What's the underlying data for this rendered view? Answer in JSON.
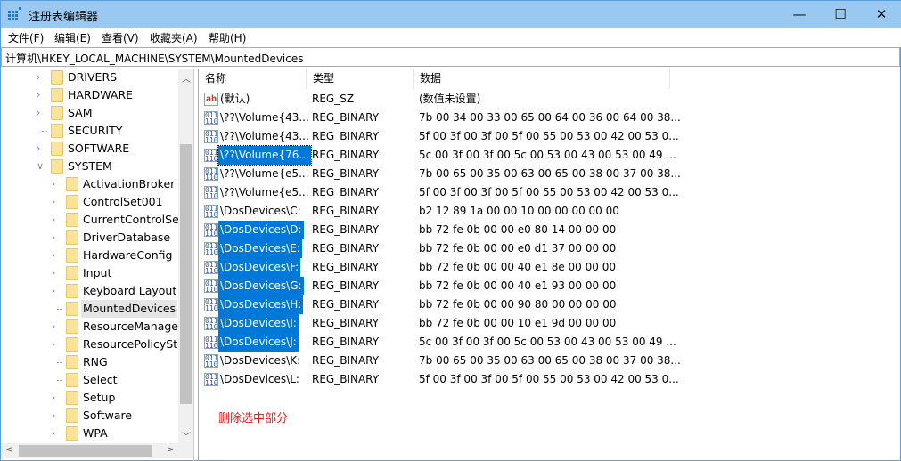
{
  "window": {
    "title": "注册表编辑器",
    "minimize": "—",
    "maximize": "☐",
    "close": "✕"
  },
  "menu": [
    "文件(F)",
    "编辑(E)",
    "查看(V)",
    "收藏夹(A)",
    "帮助(H)"
  ],
  "address": "计算机\\HKEY_LOCAL_MACHINE\\SYSTEM\\MountedDevices",
  "tree": [
    {
      "label": "DRIVERS",
      "level": 1,
      "expandable": true
    },
    {
      "label": "HARDWARE",
      "level": 1,
      "expandable": true
    },
    {
      "label": "SAM",
      "level": 1,
      "expandable": true
    },
    {
      "label": "SECURITY",
      "level": 1,
      "expandable": false
    },
    {
      "label": "SOFTWARE",
      "level": 1,
      "expandable": true
    },
    {
      "label": "SYSTEM",
      "level": 1,
      "expanded": true
    },
    {
      "label": "ActivationBroker",
      "level": 2,
      "expandable": true
    },
    {
      "label": "ControlSet001",
      "level": 2,
      "expandable": true
    },
    {
      "label": "CurrentControlSet",
      "level": 2,
      "expandable": true
    },
    {
      "label": "DriverDatabase",
      "level": 2,
      "expandable": true
    },
    {
      "label": "HardwareConfig",
      "level": 2,
      "expandable": true
    },
    {
      "label": "Input",
      "level": 2,
      "expandable": true
    },
    {
      "label": "Keyboard Layout",
      "level": 2,
      "expandable": true
    },
    {
      "label": "MountedDevices",
      "level": 2,
      "expandable": false,
      "selected": true
    },
    {
      "label": "ResourceManager",
      "level": 2,
      "expandable": true
    },
    {
      "label": "ResourcePolicySto",
      "level": 2,
      "expandable": true
    },
    {
      "label": "RNG",
      "level": 2,
      "expandable": false
    },
    {
      "label": "Select",
      "level": 2,
      "expandable": false
    },
    {
      "label": "Setup",
      "level": 2,
      "expandable": true
    },
    {
      "label": "Software",
      "level": 2,
      "expandable": true
    },
    {
      "label": "WPA",
      "level": 2,
      "expandable": true
    }
  ],
  "columns": {
    "name": "名称",
    "type": "类型",
    "data": "数据"
  },
  "rows": [
    {
      "name": "(默认)",
      "type": "REG_SZ",
      "data": "(数值未设置)",
      "icon": "string"
    },
    {
      "name": "\\??\\Volume{43...",
      "type": "REG_BINARY",
      "data": "7b 00 34 00 33 00 65 00 64 00 36 00 64 00 38...",
      "icon": "binary"
    },
    {
      "name": "\\??\\Volume{43...",
      "type": "REG_BINARY",
      "data": "5f 00 3f 00 3f 00 5f 00 55 00 53 00 42 00 53 0...",
      "icon": "binary"
    },
    {
      "name": "\\??\\Volume{76...",
      "type": "REG_BINARY",
      "data": "5c 00 3f 00 3f 00 5c 00 53 00 43 00 53 00 49 ...",
      "icon": "binary",
      "selected": true,
      "focused": true
    },
    {
      "name": "\\??\\Volume{e5...",
      "type": "REG_BINARY",
      "data": "7b 00 65 00 35 00 63 00 65 00 38 00 37 00 38...",
      "icon": "binary"
    },
    {
      "name": "\\??\\Volume{e5...",
      "type": "REG_BINARY",
      "data": "5f 00 3f 00 3f 00 5f 00 55 00 53 00 42 00 53 0...",
      "icon": "binary"
    },
    {
      "name": "\\DosDevices\\C:",
      "type": "REG_BINARY",
      "data": "b2 12 89 1a 00 00 10 00 00 00 00 00",
      "icon": "binary"
    },
    {
      "name": "\\DosDevices\\D:",
      "type": "REG_BINARY",
      "data": "bb 72 fe 0b 00 00 e0 80 14 00 00 00",
      "icon": "binary",
      "selected": true
    },
    {
      "name": "\\DosDevices\\E:",
      "type": "REG_BINARY",
      "data": "bb 72 fe 0b 00 00 e0 d1 37 00 00 00",
      "icon": "binary",
      "selected": true
    },
    {
      "name": "\\DosDevices\\F:",
      "type": "REG_BINARY",
      "data": "bb 72 fe 0b 00 00 40 e1 8e 00 00 00",
      "icon": "binary",
      "selected": true
    },
    {
      "name": "\\DosDevices\\G:",
      "type": "REG_BINARY",
      "data": "bb 72 fe 0b 00 00 40 e1 93 00 00 00",
      "icon": "binary",
      "selected": true
    },
    {
      "name": "\\DosDevices\\H:",
      "type": "REG_BINARY",
      "data": "bb 72 fe 0b 00 00 90 80 00 00 00 00",
      "icon": "binary",
      "selected": true
    },
    {
      "name": "\\DosDevices\\I:",
      "type": "REG_BINARY",
      "data": "bb 72 fe 0b 00 00 10 e1 9d 00 00 00",
      "icon": "binary",
      "selected": true
    },
    {
      "name": "\\DosDevices\\J:",
      "type": "REG_BINARY",
      "data": "5c 00 3f 00 3f 00 5c 00 53 00 43 00 53 00 49 ...",
      "icon": "binary",
      "selected": true
    },
    {
      "name": "\\DosDevices\\K:",
      "type": "REG_BINARY",
      "data": "7b 00 65 00 35 00 63 00 65 00 38 00 37 00 38...",
      "icon": "binary"
    },
    {
      "name": "\\DosDevices\\L:",
      "type": "REG_BINARY",
      "data": "5f 00 3f 00 3f 00 5f 00 55 00 53 00 42 00 53 0...",
      "icon": "binary"
    }
  ],
  "annotation": "删除选中部分",
  "colors": {
    "selection": "#0078d7",
    "titlebar": "#99c9f1",
    "annotation": "#e02020"
  }
}
